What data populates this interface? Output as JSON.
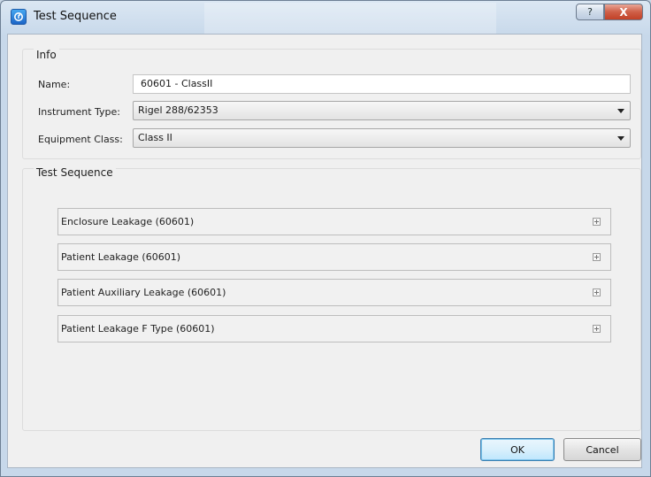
{
  "window": {
    "title": "Test Sequence"
  },
  "caption_buttons": {
    "help": "?",
    "close": "X"
  },
  "info": {
    "group_label": "Info",
    "name_label": "Name:",
    "name_value": "60601 - ClassII",
    "instrument_label": "Instrument Type:",
    "instrument_value": "Rigel 288/62353",
    "class_label": "Equipment Class:",
    "class_value": "Class II"
  },
  "sequence": {
    "group_label": "Test Sequence",
    "items": [
      {
        "label": "Enclosure Leakage (60601)"
      },
      {
        "label": "Patient Leakage (60601)"
      },
      {
        "label": "Patient Auxiliary Leakage (60601)"
      },
      {
        "label": "Patient Leakage F Type (60601)"
      }
    ]
  },
  "buttons": {
    "ok": "OK",
    "cancel": "Cancel"
  },
  "icons": {
    "app": "app-logo-icon",
    "help": "help-icon",
    "close": "close-icon",
    "expand": "expand-icon",
    "dropdown": "chevron-down-icon"
  }
}
